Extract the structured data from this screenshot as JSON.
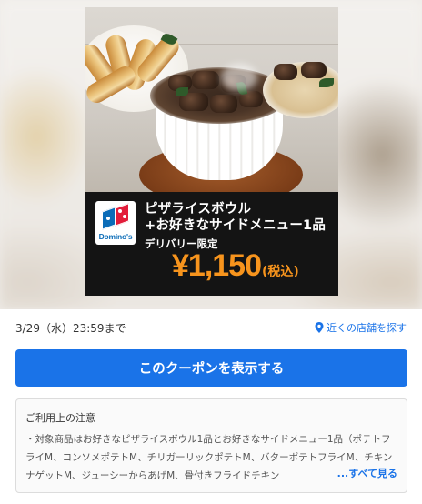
{
  "banner": {
    "brand": "Domino's",
    "headline_line1": "ピザライスボウル",
    "headline_line2": "+お好きなサイドメニュー1品",
    "tagline": "デリバリー限定",
    "price": "¥1,150",
    "tax_note": "(税込)"
  },
  "coupon": {
    "deadline": "3/29（水）23:59まで",
    "store_link_label": "近くの店舗を探す",
    "show_button_label": "このクーポンを表示する"
  },
  "notes": {
    "title": "ご利用上の注意",
    "body": "・対象商品はお好きなピザライスボウル1品とお好きなサイドメニュー1品（ポテトフライM、コンソメポテトM、チリガーリックポテトM、バターポテトフライM、チキンナゲットM、ジューシーからあげM、骨付きフライドチキン",
    "more_label": "...すべて見る"
  },
  "colors": {
    "accent": "#1a73e8",
    "price": "#f7941d",
    "promo_bg": "#141414",
    "logo_blue": "#0a6cb8",
    "logo_red": "#e21c3a"
  }
}
